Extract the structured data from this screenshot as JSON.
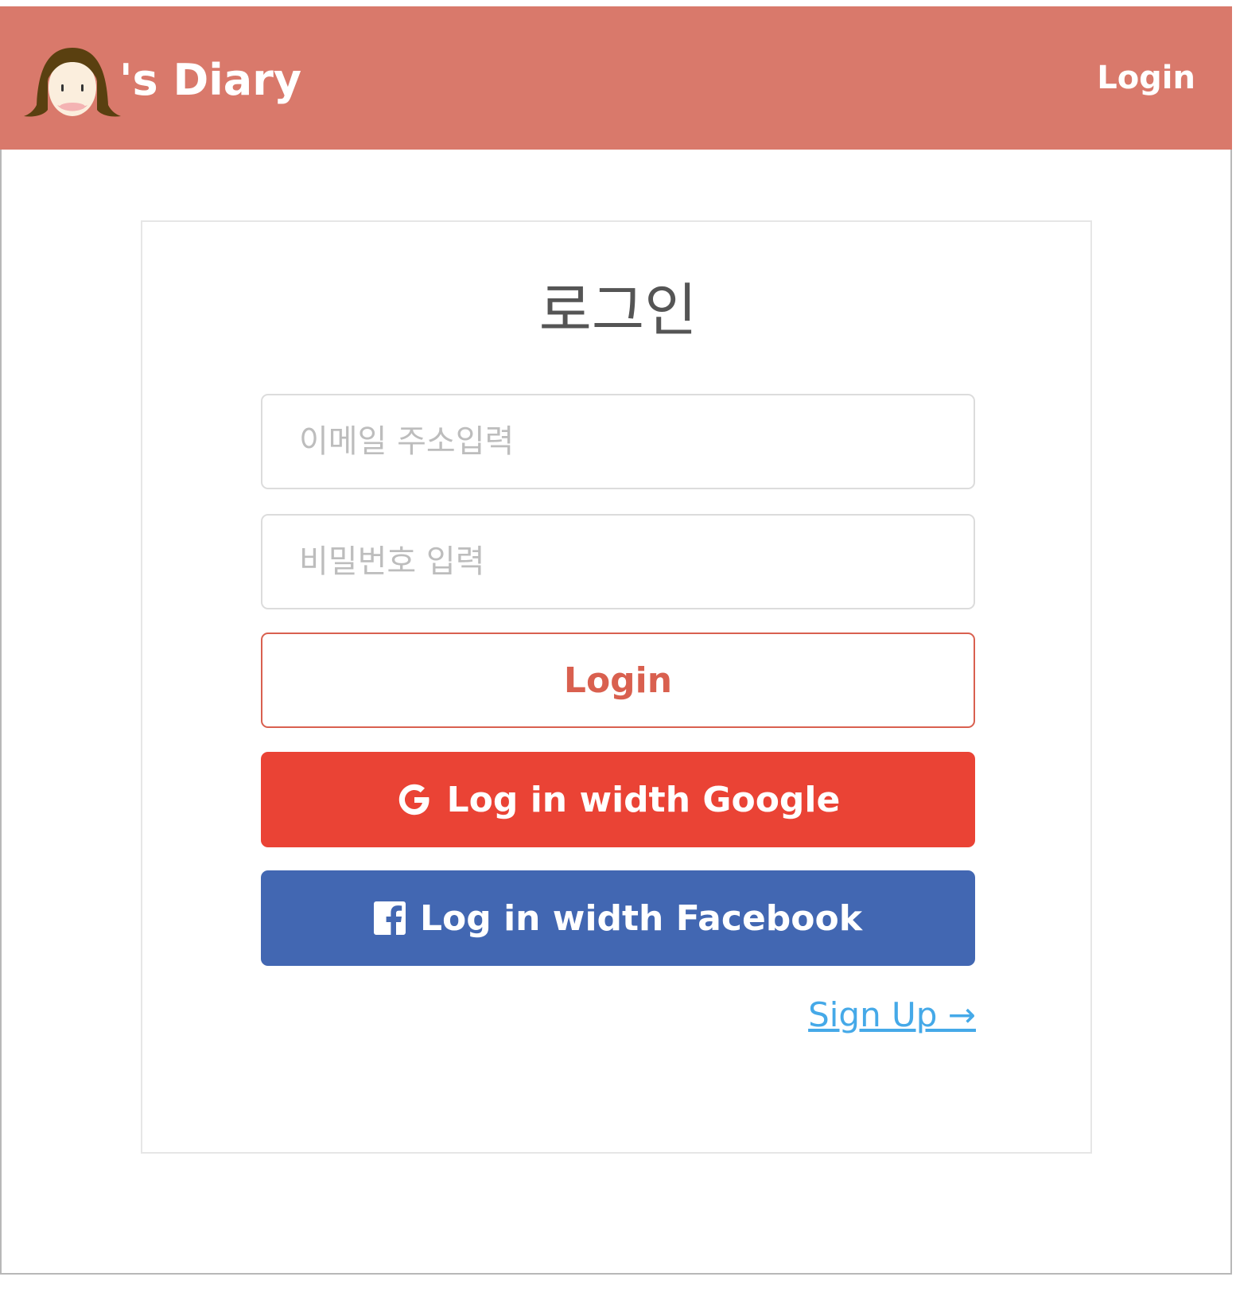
{
  "header": {
    "brand_text": "'s Diary",
    "login_link": "Login",
    "background_color": "#d9796b"
  },
  "login_card": {
    "title": "로그인",
    "email_input": {
      "placeholder": "이메일 주소입력",
      "value": ""
    },
    "password_input": {
      "placeholder": "비밀번호 입력",
      "value": ""
    },
    "login_button": "Login",
    "google_button": {
      "label": "Log in width Google",
      "icon": "google-icon",
      "color": "#ea4335"
    },
    "facebook_button": {
      "label": "Log in width Facebook",
      "icon": "facebook-icon",
      "color": "#4267b2"
    },
    "signup_link": "Sign Up →"
  },
  "colors": {
    "accent": "#d9604f",
    "link": "#45a9e8"
  }
}
